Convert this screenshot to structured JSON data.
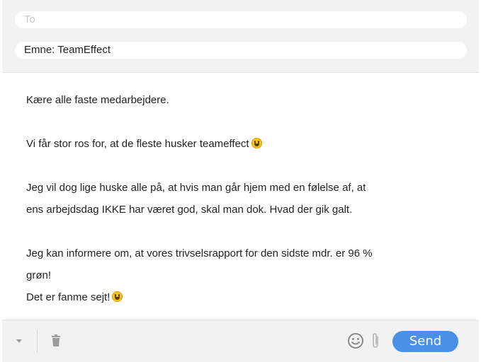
{
  "header": {
    "to_placeholder": "To",
    "subject_text": "Emne: TeamEffect"
  },
  "body": {
    "lines": [
      "Kære alle faste medarbejdere.",
      "",
      "Vi får stor ros for, at de fleste husker teameffect",
      "",
      "Jeg vil dog lige huske alle på, at hvis man går hjem med en følelse af, at",
      "ens arbejdsdag IKKE har været god, skal man dok. Hvad der gik galt.",
      "",
      "Jeg kan informere om, at vores trivselsrapport for den sidste mdr. er 96 %",
      "grøn!",
      "Det er fanme sejt!"
    ],
    "emojis": [
      "grinning-face-emoji",
      "grinning-face-emoji"
    ]
  },
  "footer": {
    "send_label": "Send",
    "icons": [
      "chevron-down-icon",
      "trash-icon",
      "smiley-icon",
      "paperclip-icon"
    ]
  },
  "colors": {
    "send_button": "#4a90e8",
    "toolbar_background": "#f2f2f2",
    "icon_gray": "#9a9a9a"
  }
}
